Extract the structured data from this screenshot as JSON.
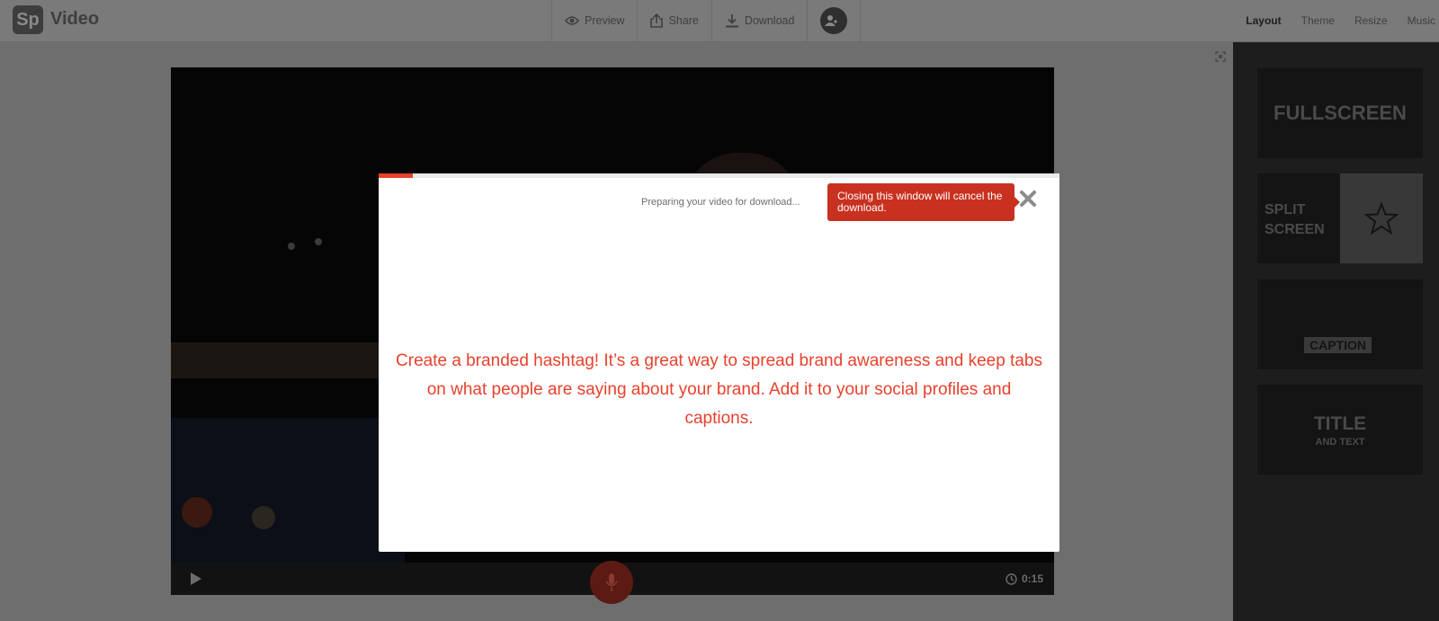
{
  "app": {
    "logo": "Sp",
    "title": "Video"
  },
  "topnav": {
    "preview": "Preview",
    "share": "Share",
    "download": "Download"
  },
  "tabs": [
    "Layout",
    "Theme",
    "Resize",
    "Music"
  ],
  "active_tab": "Layout",
  "player": {
    "time": "0:15"
  },
  "layouts": {
    "fullscreen": "FULLSCREEN",
    "split_line1": "SPLIT",
    "split_line2": "SCREEN",
    "caption": "CAPTION",
    "title": "TITLE",
    "title_sub": "AND TEXT"
  },
  "modal": {
    "status": "Preparing your video for download...",
    "progress": 0.05,
    "tooltip": "Closing this window will cancel the download.",
    "tip": "Create a branded hashtag! It’s a great way to spread brand awareness and keep tabs on what people are saying about your brand. Add it to your social profiles and captions."
  },
  "colors": {
    "accent": "#e8412c",
    "tooltip_bg": "#c8311f"
  }
}
